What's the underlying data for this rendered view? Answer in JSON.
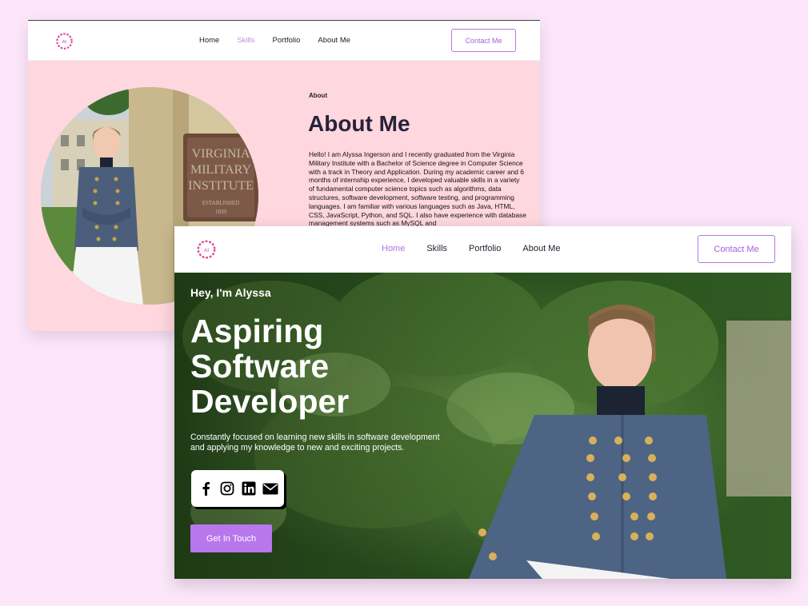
{
  "back_page": {
    "nav": {
      "logo_text": "AI",
      "links": [
        "Home",
        "Skills",
        "Portfolio",
        "About Me"
      ],
      "active_link": "Skills",
      "contact_label": "Contact Me"
    },
    "photo_sign": [
      "VIRGINIA",
      "MILITARY",
      "INSTITUTE",
      "ESTABLISHED",
      "1839"
    ],
    "about": {
      "kicker": "About",
      "title": "About Me",
      "body": "Hello! I am Alyssa Ingerson and I recently graduated from the Virginia Military Institute with a Bachelor of Science degree in Computer Science with a track in Theory and Application. During my academic career and 6 months of internship experience, I developed valuable skills in a variety of fundamental computer science topics such as algorithms, data structures, software development, software testing, and programming languages. I am familiar with various languages such as Java, HTML, CSS, JavaScript, Python, and SQL. I also have experience with database management systems such as MySQL and"
    }
  },
  "front_page": {
    "nav": {
      "logo_text": "AI",
      "links": [
        "Home",
        "Skills",
        "Portfolio",
        "About Me"
      ],
      "active_link": "Home",
      "contact_label": "Contact Me"
    },
    "hero": {
      "greeting": "Hey, I'm Alyssa",
      "title_lines": [
        "Aspiring",
        "Software",
        "Developer"
      ],
      "subtitle": "Constantly focused on learning new skills in software development and applying my knowledge to new and exciting projects.",
      "socials": [
        "facebook-icon",
        "instagram-icon",
        "linkedin-icon",
        "mail-icon"
      ],
      "cta_label": "Get In Touch"
    }
  },
  "colors": {
    "page_bg": "#fce6fa",
    "accent": "#b877ec",
    "about_bg": "#ffd7de",
    "logo_pink": "#e0409a"
  }
}
